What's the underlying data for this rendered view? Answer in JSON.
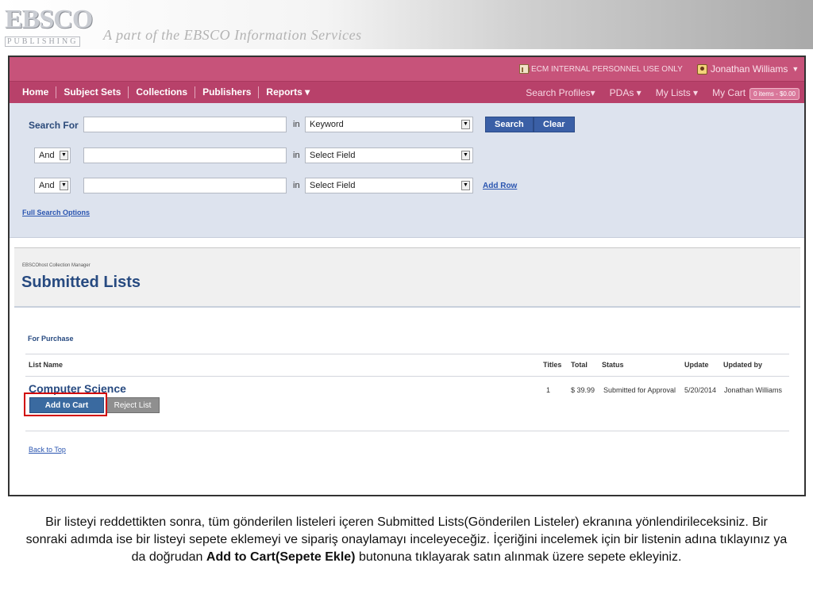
{
  "slide": {
    "logo_top": "EBSCO",
    "logo_bottom": "PUBLISHING",
    "tagline": "A part of the EBSCO Information Services",
    "caption_part1": "Bir listeyi reddettikten sonra, tüm gönderilen listeleri içeren Submitted Lists(Gönderilen Listeler) ekranına yönlendirileceksiniz. Bir sonraki adımda ise bir listeyi sepete eklemeyi ve sipariş onaylamayı inceleyeceğiz. İçeriğini incelemek için bir listenin adına tıklayınız ya da doğrudan ",
    "caption_bold": "Add to Cart(Sepete Ekle)",
    "caption_part2": " butonuna tıklayarak satın alınmak üzere sepete ekleyiniz."
  },
  "topbar": {
    "notice": "ECM INTERNAL PERSONNEL USE ONLY",
    "user_name": "Jonathan Williams",
    "caret": "▼"
  },
  "nav": {
    "left": [
      "Home",
      "Subject Sets",
      "Collections",
      "Publishers",
      "Reports ▾"
    ],
    "right": [
      "Search Profiles▾",
      "PDAs ▾",
      "My Lists ▾"
    ],
    "cart_label": "My Cart",
    "cart_badge": "0 items - $0.00"
  },
  "search": {
    "label": "Search For",
    "in_label": "in",
    "row1_field": "Keyword",
    "row2_bool": "And",
    "row2_field": "Select Field",
    "row3_bool": "And",
    "row3_field": "Select Field",
    "search_button": "Search",
    "clear_button": "Clear",
    "add_row": "Add Row",
    "full_options": "Full Search Options",
    "arrow": "▼"
  },
  "page": {
    "breadcrumb": "EBSCOhost Collection Manager",
    "title": "Submitted Lists"
  },
  "lists": {
    "section_label": "For Purchase",
    "columns": {
      "name": "List Name",
      "titles": "Titles",
      "total": "Total",
      "status": "Status",
      "update": "Update",
      "updated_by": "Updated by"
    },
    "rows": [
      {
        "name": "Computer Science",
        "titles": "1",
        "total": "$ 39.99",
        "status": "Submitted for Approval",
        "update": "5/20/2014",
        "updated_by": "Jonathan Williams",
        "add_button": "Add to Cart",
        "reject_button": "Reject List"
      }
    ],
    "back_to_top": "Back to Top"
  },
  "colors": {
    "topbar": "#c7537a",
    "navbar": "#b8416a",
    "search_panel": "#dde3ee",
    "accent_blue": "#274a80",
    "highlight": "#d10000"
  }
}
